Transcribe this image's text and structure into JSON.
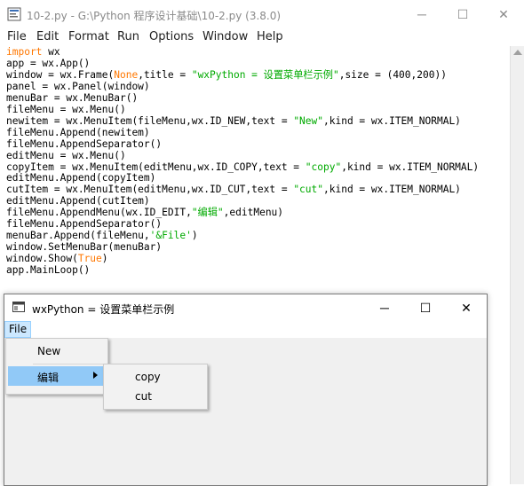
{
  "idle": {
    "title": "10-2.py - G:\\Python 程序设计基础\\10-2.py (3.8.0)",
    "menu": [
      "File",
      "Edit",
      "Format",
      "Run",
      "Options",
      "Window",
      "Help"
    ],
    "controls": {
      "minimize": "─",
      "maximize": "☐",
      "close": "✕"
    }
  },
  "code_lines": [
    [
      [
        "kw",
        "import"
      ],
      [
        "t",
        " wx"
      ]
    ],
    [
      [
        "t",
        "app = wx.App()"
      ]
    ],
    [
      [
        "t",
        "window = wx.Frame("
      ],
      [
        "kw",
        "None"
      ],
      [
        "t",
        ",title = "
      ],
      [
        "str",
        "\"wxPython = 设置菜单栏示例\""
      ],
      [
        "t",
        ",size = (400,200))"
      ]
    ],
    [
      [
        "t",
        "panel = wx.Panel(window)"
      ]
    ],
    [
      [
        "t",
        "menuBar = wx.MenuBar()"
      ]
    ],
    [
      [
        "t",
        "fileMenu = wx.Menu()"
      ]
    ],
    [
      [
        "t",
        "newitem = wx.MenuItem(fileMenu,wx.ID_NEW,text = "
      ],
      [
        "str",
        "\"New\""
      ],
      [
        "t",
        ",kind = wx.ITEM_NORMAL)"
      ]
    ],
    [
      [
        "t",
        "fileMenu.Append(newitem)"
      ]
    ],
    [
      [
        "t",
        "fileMenu.AppendSeparator()"
      ]
    ],
    [
      [
        "t",
        "editMenu = wx.Menu()"
      ]
    ],
    [
      [
        "t",
        "copyItem = wx.MenuItem(editMenu,wx.ID_COPY,text = "
      ],
      [
        "str",
        "\"copy\""
      ],
      [
        "t",
        ",kind = wx.ITEM_NORMAL)"
      ]
    ],
    [
      [
        "t",
        "editMenu.Append(copyItem)"
      ]
    ],
    [
      [
        "t",
        "cutItem = wx.MenuItem(editMenu,wx.ID_CUT,text = "
      ],
      [
        "str",
        "\"cut\""
      ],
      [
        "t",
        ",kind = wx.ITEM_NORMAL)"
      ]
    ],
    [
      [
        "t",
        "editMenu.Append(cutItem)"
      ]
    ],
    [
      [
        "t",
        "fileMenu.AppendMenu(wx.ID_EDIT,"
      ],
      [
        "str",
        "\"编辑\""
      ],
      [
        "t",
        ",editMenu)"
      ]
    ],
    [
      [
        "t",
        "fileMenu.AppendSeparator()"
      ]
    ],
    [
      [
        "t",
        "menuBar.Append(fileMenu,"
      ],
      [
        "str",
        "'&File'"
      ],
      [
        "t",
        ")"
      ]
    ],
    [
      [
        "t",
        "window.SetMenuBar(menuBar)"
      ]
    ],
    [
      [
        "t",
        "window.Show("
      ],
      [
        "kw",
        "True"
      ],
      [
        "t",
        ")"
      ]
    ],
    [
      [
        "t",
        "app.MainLoop()"
      ]
    ]
  ],
  "wx": {
    "title": "wxPython = 设置菜单栏示例",
    "menu_file": "File",
    "controls": {
      "minimize": "─",
      "maximize": "☐",
      "close": "✕"
    },
    "file_menu": {
      "new": "New",
      "edit": "编辑"
    },
    "edit_menu": {
      "copy": "copy",
      "cut": "cut"
    }
  },
  "colors": {
    "keyword": "#ff7700",
    "string": "#00aa00",
    "menu_highlight": "#91c9f7"
  },
  "icons": [
    "idle-app-icon",
    "wx-window-icon",
    "submenu-arrow-icon",
    "scroll-up-icon"
  ]
}
